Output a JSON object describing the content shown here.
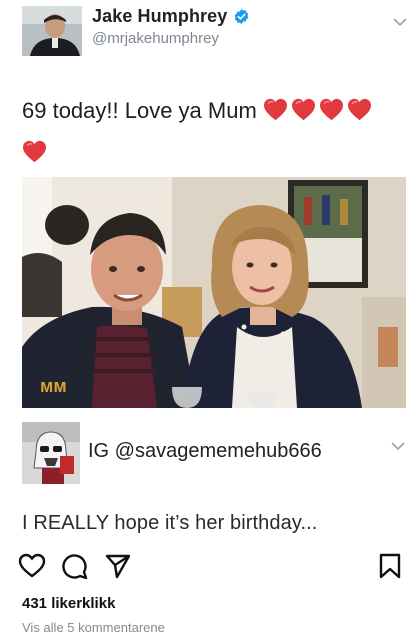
{
  "tweet": {
    "author_name": "Jake Humphrey",
    "author_handle": "@mrjakehumphrey",
    "text": "69 today!! Love ya Mum",
    "emoji": "heart-icon",
    "heart_count": 5,
    "heart_color": "#e0393e",
    "verified_color": "#1d9bf0"
  },
  "quote": {
    "author_label": "IG @savagememehub666",
    "reply_text": "I REALLY hope it’s her birthday..."
  },
  "instagram": {
    "likes": "431 likerklikk",
    "comments_link": "Vis alle 5 kommentarene"
  },
  "photo": {
    "description_icon": "photo-selfie-image"
  }
}
